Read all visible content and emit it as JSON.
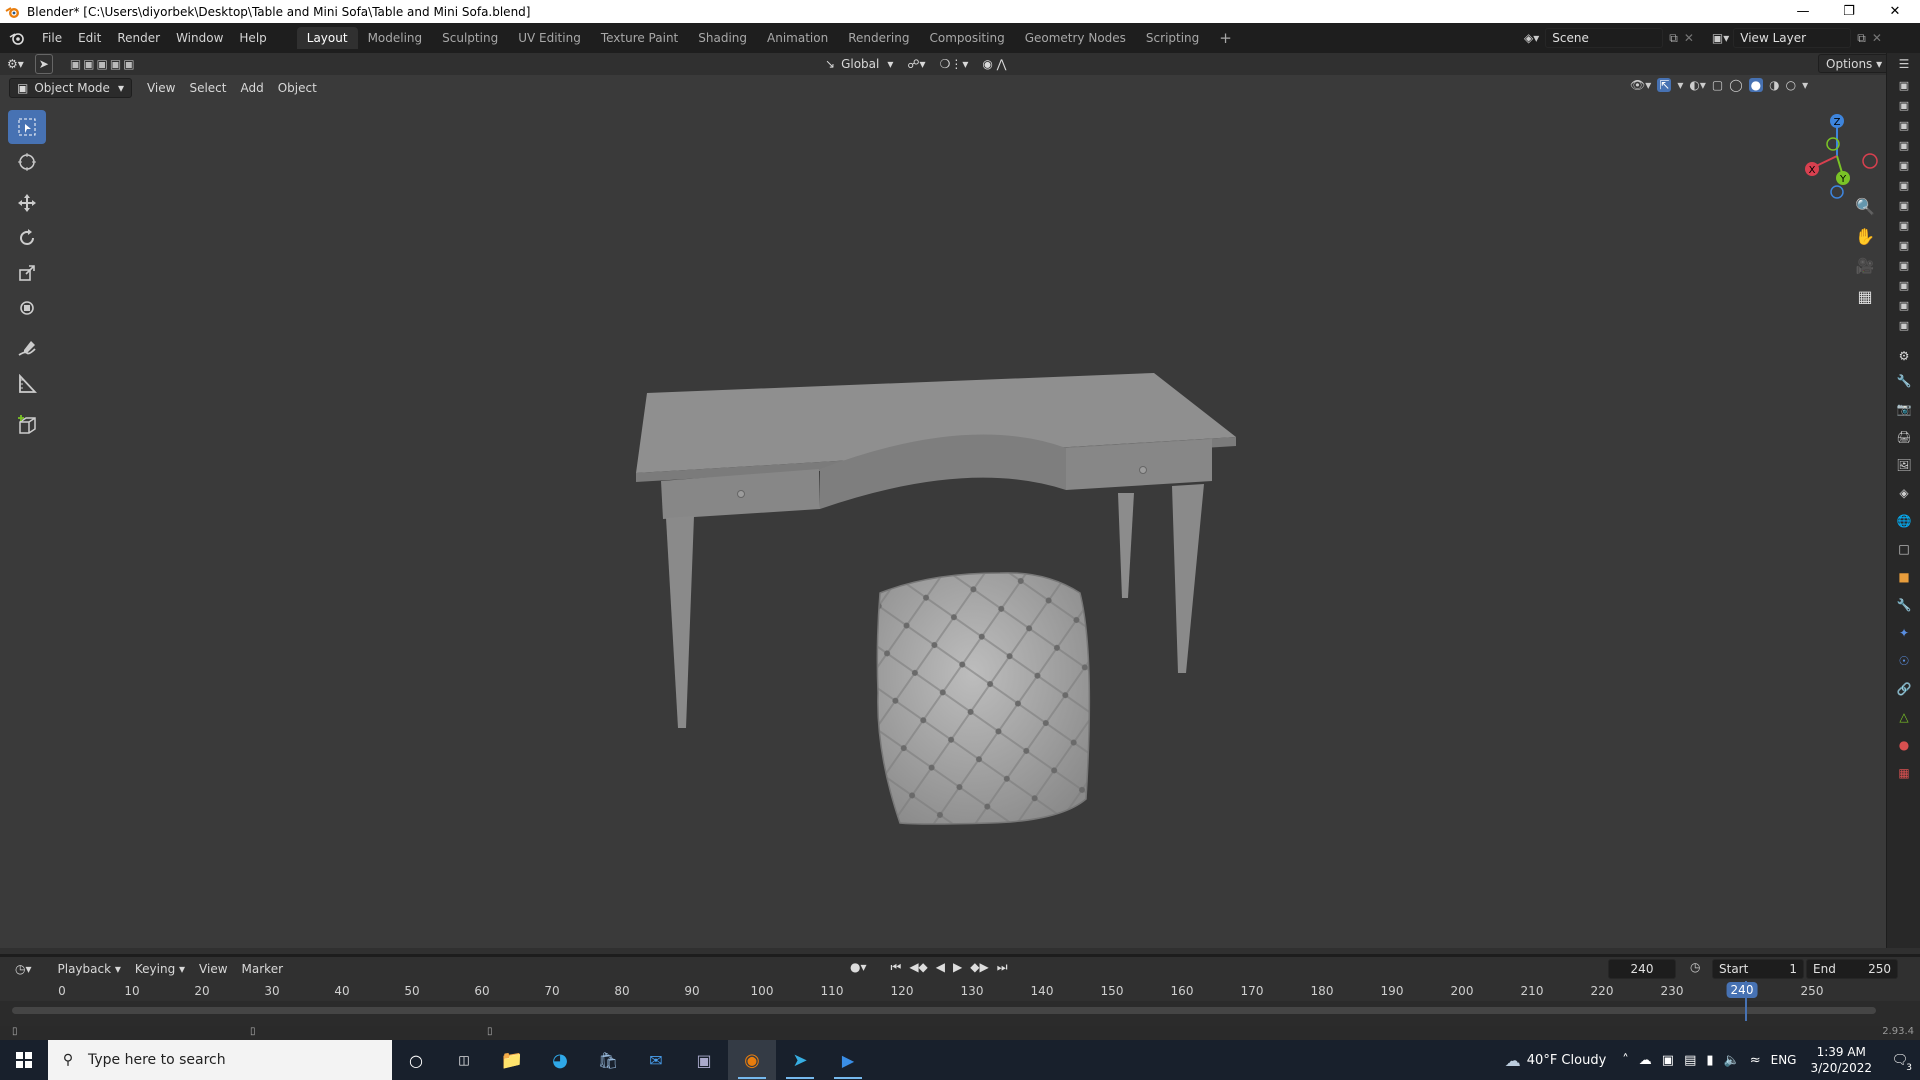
{
  "window": {
    "title": "Blender* [C:\\Users\\diyorbek\\Desktop\\Table and Mini Sofa\\Table and Mini Sofa.blend]",
    "controls": [
      "minimize",
      "restore",
      "close"
    ]
  },
  "menubar": {
    "items": [
      "File",
      "Edit",
      "Render",
      "Window",
      "Help"
    ]
  },
  "workspaces": {
    "tabs": [
      "Layout",
      "Modeling",
      "Sculpting",
      "UV Editing",
      "Texture Paint",
      "Shading",
      "Animation",
      "Rendering",
      "Compositing",
      "Geometry Nodes",
      "Scripting"
    ],
    "active": "Layout",
    "add_label": "+"
  },
  "scene": {
    "name": "Scene",
    "view_layer": "View Layer"
  },
  "tool_settings": {
    "transform_orientation": "Global",
    "options_label": "Options"
  },
  "viewport_header": {
    "mode": "Object Mode",
    "menus": [
      "View",
      "Select",
      "Add",
      "Object"
    ]
  },
  "gizmo": {
    "x": "X",
    "y": "Y",
    "z": "Z"
  },
  "timeline": {
    "menus": [
      "Playback",
      "Keying",
      "View",
      "Marker"
    ],
    "current_frame": "240",
    "start_label": "Start",
    "start_value": "1",
    "end_label": "End",
    "end_value": "250",
    "ticks": [
      "0",
      "10",
      "20",
      "30",
      "40",
      "50",
      "60",
      "70",
      "80",
      "90",
      "100",
      "110",
      "120",
      "130",
      "140",
      "150",
      "160",
      "170",
      "180",
      "190",
      "200",
      "210",
      "220",
      "230",
      "240",
      "250"
    ],
    "playhead": "240"
  },
  "statusbar": {
    "version": "2.93.4"
  },
  "taskbar": {
    "search_placeholder": "Type here to search",
    "weather": "40°F  Cloudy",
    "language": "ENG",
    "time": "1:39 AM",
    "date": "3/20/2022",
    "notification_count": "3"
  },
  "colors": {
    "accent": "#4772b3",
    "viewport_bg": "#3a3a3a",
    "gizmo_x": "#d8404f",
    "gizmo_y": "#7ac326",
    "gizmo_z": "#3e85dd"
  }
}
